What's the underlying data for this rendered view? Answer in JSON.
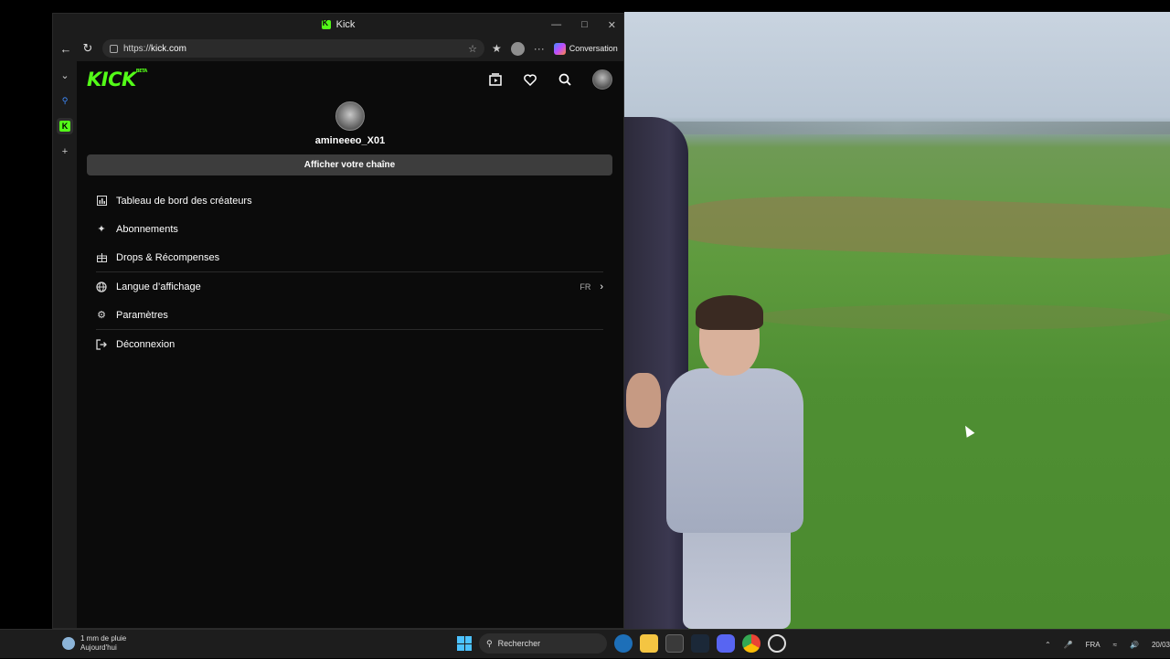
{
  "browser": {
    "tab_title": "Kick",
    "url_prefix": "https://",
    "url_host": "kick.com",
    "copilot_label": "Conversation"
  },
  "kick": {
    "logo_text": "KICK",
    "logo_badge": "BETA",
    "username": "amineeeo_X01",
    "channel_button": "Afficher votre chaîne",
    "menu": [
      {
        "label": "Tableau de bord des créateurs",
        "icon": "chart-icon"
      },
      {
        "label": "Abonnements",
        "icon": "sparkle-icon"
      },
      {
        "label": "Drops & Récompenses",
        "icon": "gift-icon"
      },
      {
        "label": "Langue d’affichage",
        "icon": "globe-icon",
        "value": "FR"
      },
      {
        "label": "Paramètres",
        "icon": "gear-icon"
      },
      {
        "label": "Déconnexion",
        "icon": "logout-icon"
      }
    ]
  },
  "taskbar": {
    "weather_line1": "1 mm de pluie",
    "weather_line2": "Aujourd'hui",
    "search_placeholder": "Rechercher",
    "lang": "FRA",
    "date": "20/03"
  },
  "colors": {
    "kick_green": "#53fc18",
    "background": "#0b0b0b",
    "button_bg": "#3d3d3d"
  }
}
